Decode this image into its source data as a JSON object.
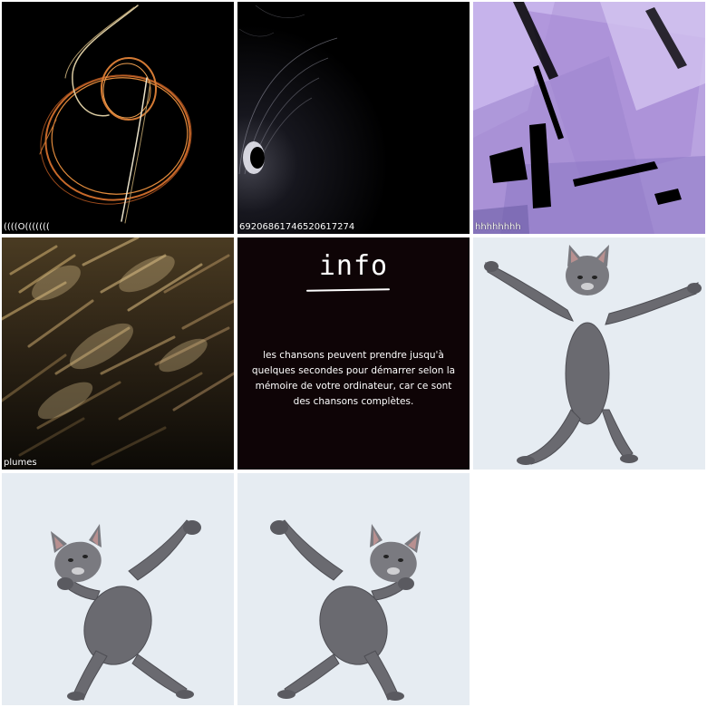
{
  "tiles": [
    {
      "caption": "((((O(((((((",
      "icon": "orange-swirl-fractal-art"
    },
    {
      "caption": "69206861746520617274",
      "icon": "dark-tunnel-fractal-art"
    },
    {
      "caption": "hhhhhhhh",
      "icon": "purple-shards-fractal-art"
    },
    {
      "caption": "plumes",
      "icon": "golden-feathers-fractal-art"
    },
    {
      "icon": "dancing-cat-photo"
    },
    {
      "icon": "dancing-cat-photo"
    },
    {
      "icon": "dancing-cat-photo"
    }
  ],
  "info": {
    "title": "info",
    "text": "les chansons peuvent prendre jusqu'à quelques secondes pour démarrer selon la mémoire de votre ordinateur, car ce sont des chansons complètes."
  },
  "colors": {
    "page_background": "#ffffff",
    "info_background": "#0e0406",
    "cat_background": "#e6ecf2"
  }
}
